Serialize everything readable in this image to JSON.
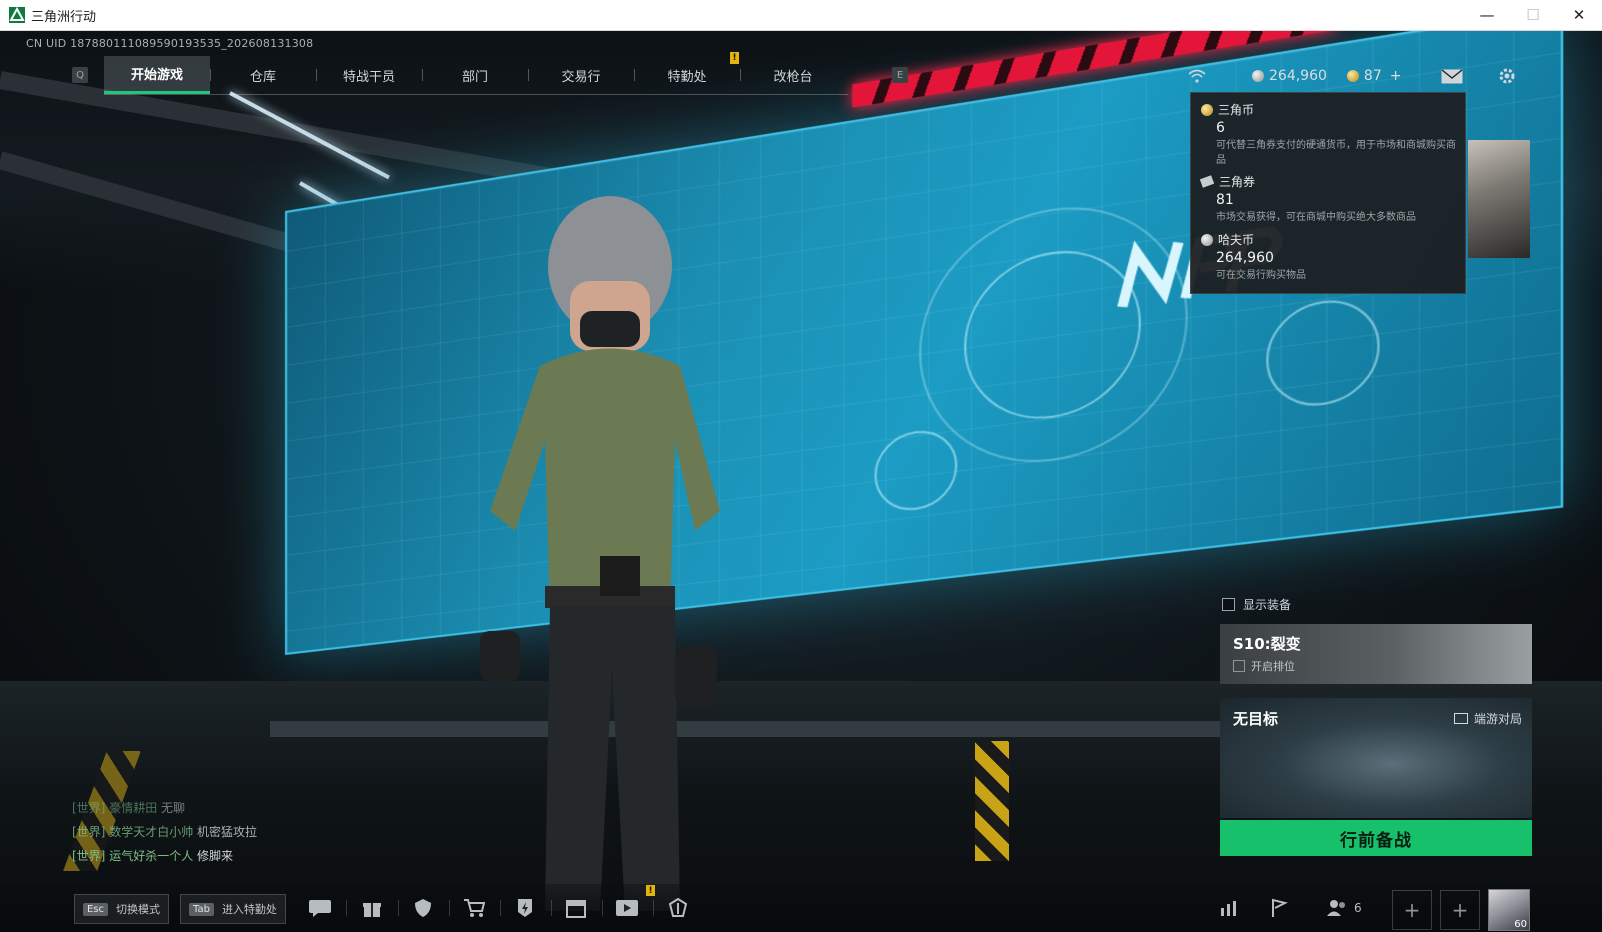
{
  "window": {
    "title": "三角洲行动",
    "minimize": "—",
    "maximize": "☐",
    "close": "✕"
  },
  "uid": "CN UID 18788011108959019353​5_202608131308",
  "nav": {
    "left_key": "Q",
    "right_key": "E",
    "tabs": [
      "开始游戏",
      "仓库",
      "特战干员",
      "部门",
      "交易行",
      "特勤处",
      "改枪台"
    ],
    "active": 0,
    "alert": "!"
  },
  "currency": {
    "haf_coin": "264,960",
    "tri_coin": "87",
    "add": "+"
  },
  "tooltip": {
    "items": [
      {
        "name": "三角币",
        "value": "6",
        "desc": "可代替三角券支付的硬通货币，用于市场和商城购买商品"
      },
      {
        "name": "三角券",
        "value": "81",
        "desc": "市场交易获得，可在商城中购买绝大多数商品"
      },
      {
        "name": "哈夫币",
        "value": "264,960",
        "desc": "可在交易行购买物品"
      }
    ]
  },
  "right_panel": {
    "show_equipment": "显示装备",
    "season_title": "S10:裂变",
    "season_sub": "开启排位",
    "map_title": "无目标",
    "map_mode": "端游对局",
    "start_button": "行前备战"
  },
  "chat": [
    {
      "channel": "[世界]",
      "name": "豪情耕田",
      "msg": "无聊"
    },
    {
      "channel": "[世界]",
      "name": "数学天才白小帅",
      "msg": "机密猛攻拉"
    },
    {
      "channel": "[世界]",
      "name": "运气好杀一个人",
      "msg": "修脚来"
    }
  ],
  "bottom": {
    "esc_key": "Esc",
    "esc_label": "切换模式",
    "tab_key": "Tab",
    "tab_label": "进入特勤处",
    "alert": "!",
    "squad_count": "6",
    "slot_plus": "+",
    "avatar_level": "60"
  },
  "colors": {
    "accent_green": "#17c06b",
    "alert_yellow": "#e2b410",
    "screen_cyan": "#1c9cc4"
  }
}
